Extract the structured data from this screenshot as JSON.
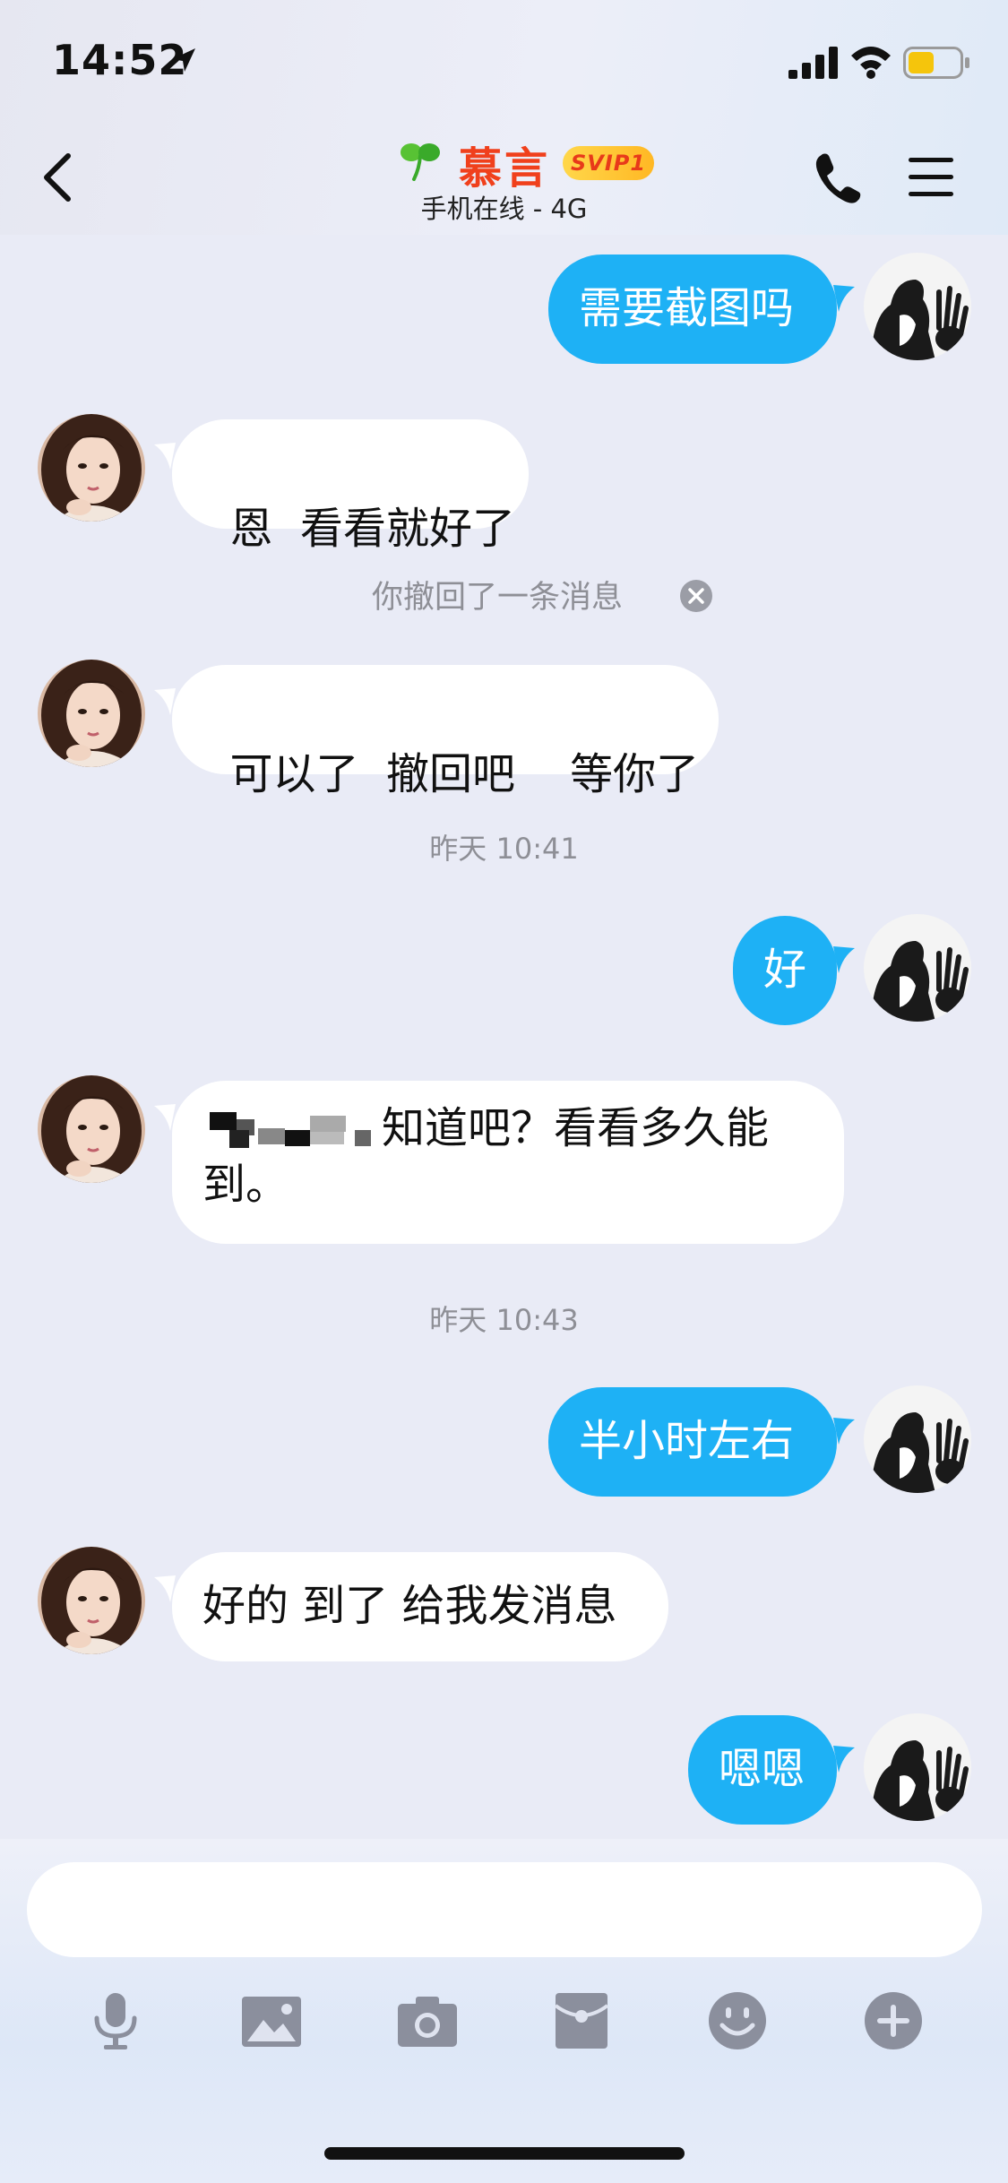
{
  "status_bar": {
    "time": "14:52"
  },
  "header": {
    "contact_name": "慕言",
    "vip_badge": "SVIP1",
    "online_status": "手机在线 - 4G"
  },
  "messages": {
    "m1": {
      "direction": "out",
      "text": "需要截图吗"
    },
    "m2": {
      "direction": "in",
      "text": "恩  看看就好了"
    },
    "recall": {
      "text": "你撤回了一条消息"
    },
    "m3": {
      "direction": "in",
      "text": "可以了  撤回吧    等你了"
    },
    "time1": "昨天 10:41",
    "m4": {
      "direction": "out",
      "text": "好"
    },
    "m5": {
      "direction": "in",
      "line1": "知道吧？看看多久能",
      "line2": "到。",
      "redacted": "pixelated"
    },
    "time2": "昨天 10:43",
    "m6": {
      "direction": "out",
      "text": "半小时左右"
    },
    "m7": {
      "direction": "in",
      "text": "好的 到了 给我发消息"
    },
    "m8": {
      "direction": "out",
      "text": "嗯嗯"
    }
  },
  "input": {
    "placeholder": ""
  },
  "toolbar": [
    "microphone-icon",
    "image-icon",
    "camera-icon",
    "red-packet-icon",
    "emoji-icon",
    "plus-icon"
  ],
  "colors": {
    "outgoing_bubble": "#1eb1f5",
    "incoming_bubble": "#ffffff",
    "contact_name": "#f0401c",
    "background": "#e9ebf6"
  }
}
